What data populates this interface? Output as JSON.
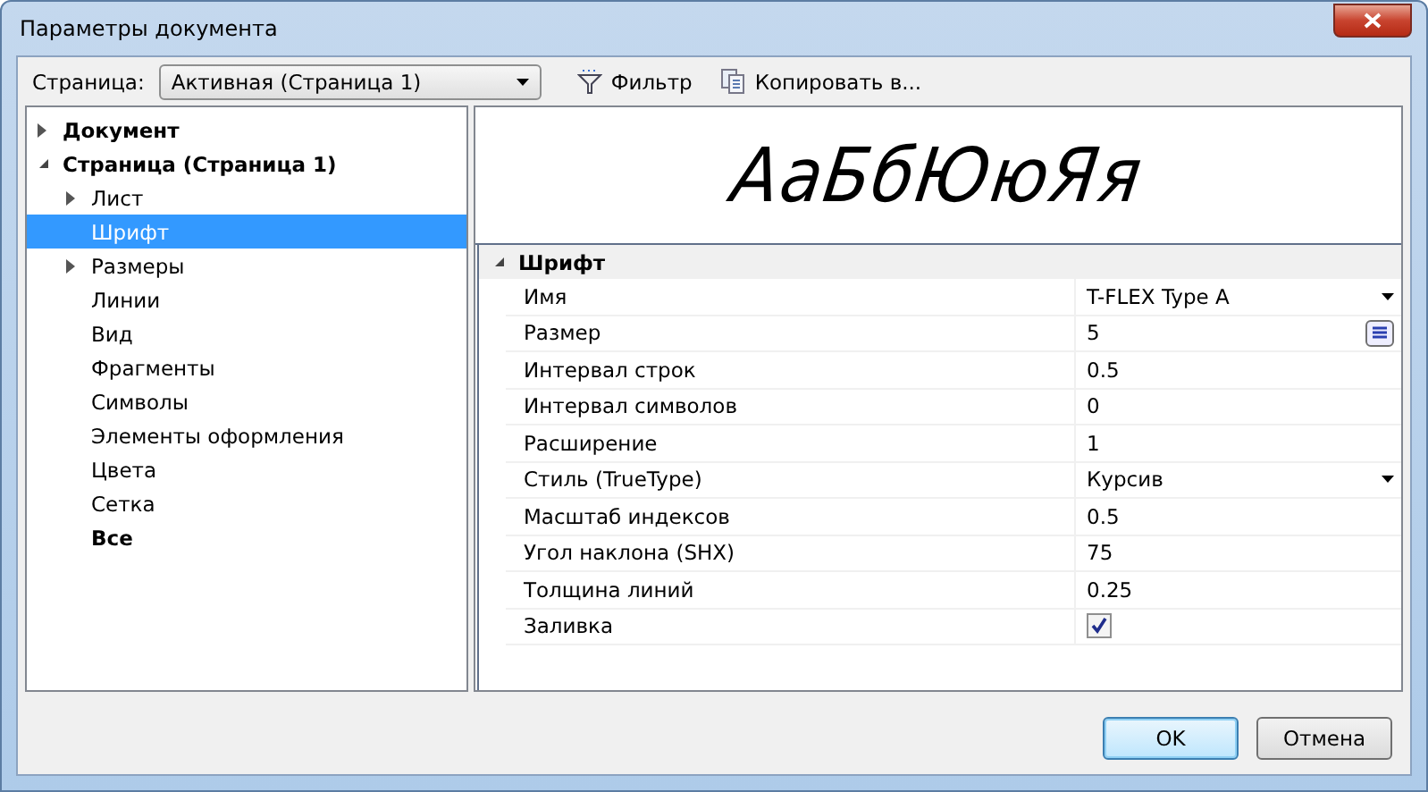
{
  "window": {
    "title": "Параметры документа"
  },
  "toolbar": {
    "page_label": "Страница:",
    "page_value": "Активная (Страница 1)",
    "filter_button": "Фильтр",
    "copy_button": "Копировать в..."
  },
  "tree": [
    {
      "label": "Документ",
      "expandable": true,
      "expanded": false,
      "selected": false,
      "emphasized": true
    },
    {
      "label": "Страница (Страница 1)",
      "expandable": true,
      "expanded": true,
      "selected": false,
      "emphasized": true,
      "children": [
        {
          "label": "Лист",
          "expandable": true,
          "expanded": false,
          "selected": false,
          "emphasized": false
        },
        {
          "label": "Шрифт",
          "expandable": false,
          "expanded": false,
          "selected": true,
          "emphasized": false
        },
        {
          "label": "Размеры",
          "expandable": true,
          "expanded": false,
          "selected": false,
          "emphasized": false
        },
        {
          "label": "Линии",
          "expandable": false,
          "expanded": false,
          "selected": false,
          "emphasized": false
        },
        {
          "label": "Вид",
          "expandable": false,
          "expanded": false,
          "selected": false,
          "emphasized": false
        },
        {
          "label": "Фрагменты",
          "expandable": false,
          "expanded": false,
          "selected": false,
          "emphasized": false
        },
        {
          "label": "Символы",
          "expandable": false,
          "expanded": false,
          "selected": false,
          "emphasized": false
        },
        {
          "label": "Элементы оформления",
          "expandable": false,
          "expanded": false,
          "selected": false,
          "emphasized": false
        },
        {
          "label": "Цвета",
          "expandable": false,
          "expanded": false,
          "selected": false,
          "emphasized": false
        },
        {
          "label": "Сетка",
          "expandable": false,
          "expanded": false,
          "selected": false,
          "emphasized": false
        },
        {
          "label": "Все",
          "expandable": false,
          "expanded": false,
          "selected": false,
          "emphasized": true
        }
      ]
    }
  ],
  "preview": {
    "sample": "АаБбЮюЯя"
  },
  "property_grid": {
    "category": "Шрифт",
    "expanded": true,
    "rows": [
      {
        "name": "Имя",
        "value": "T-FLEX Type A",
        "kind": "dropdown"
      },
      {
        "name": "Размер",
        "value": "5",
        "kind": "button"
      },
      {
        "name": "Интервал строк",
        "value": "0.5",
        "kind": "text"
      },
      {
        "name": "Интервал символов",
        "value": "0",
        "kind": "text"
      },
      {
        "name": "Расширение",
        "value": "1",
        "kind": "text"
      },
      {
        "name": "Стиль (TrueType)",
        "value": "Курсив",
        "kind": "dropdown"
      },
      {
        "name": "Масштаб индексов",
        "value": "0.5",
        "kind": "text"
      },
      {
        "name": "Угол наклона (SHX)",
        "value": "75",
        "kind": "text"
      },
      {
        "name": "Толщина линий",
        "value": "0.25",
        "kind": "text"
      },
      {
        "name": "Заливка",
        "checked": true,
        "kind": "checkbox"
      }
    ]
  },
  "buttons": [
    {
      "label": "OK",
      "default": true
    },
    {
      "label": "Отмена",
      "default": false
    }
  ]
}
